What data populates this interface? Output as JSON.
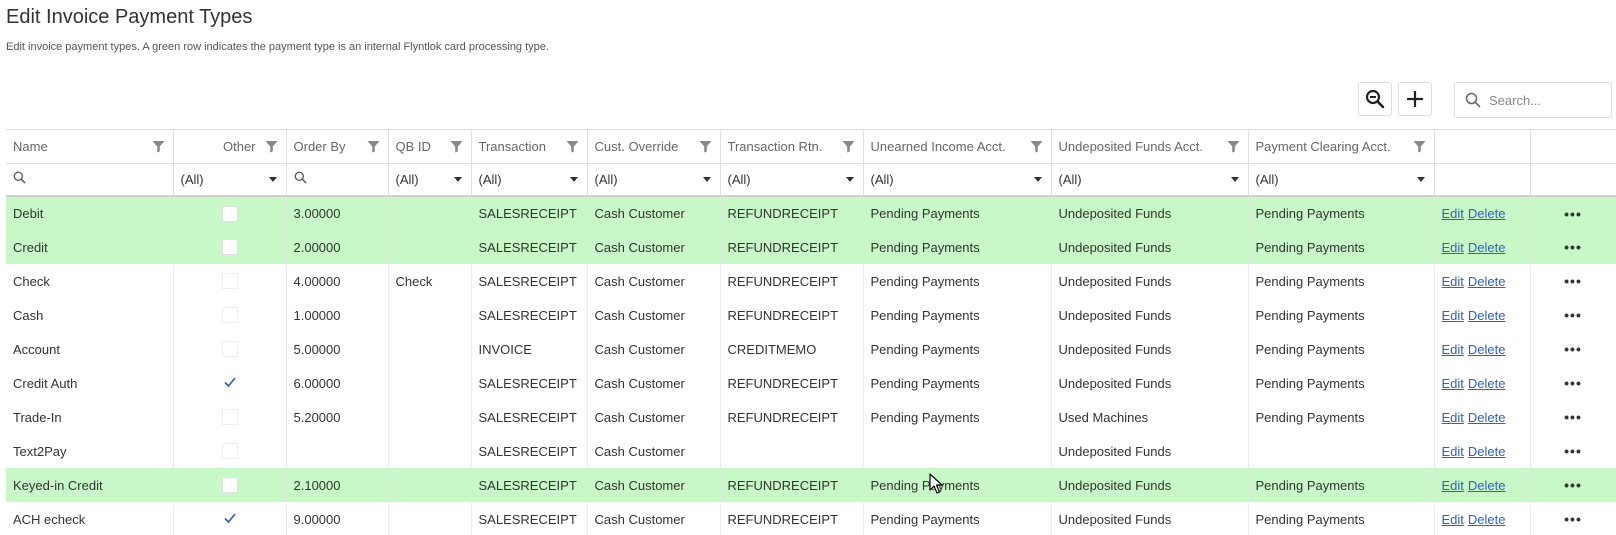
{
  "page": {
    "title": "Edit Invoice Payment Types",
    "subtitle": "Edit invoice payment types. A green row indicates the payment type is an internal Flyntlok card processing type."
  },
  "toolbar": {
    "search_placeholder": "Search...",
    "zoom_icon": "zoom-out-icon",
    "add_icon": "plus-icon"
  },
  "columns": [
    "Name",
    "Other",
    "Order By",
    "QB ID",
    "Transaction",
    "Cust. Override",
    "Transaction Rtn.",
    "Unearned Income Acct.",
    "Undeposited Funds Acct.",
    "Payment Clearing Acct."
  ],
  "filters": {
    "all": "(All)"
  },
  "actions": {
    "edit": "Edit",
    "delete": "Delete",
    "more": "•••"
  },
  "colors": {
    "internal_row": "#c8f8c8",
    "link": "#3060c0"
  },
  "rows": [
    {
      "name": "Debit",
      "other": "white",
      "order_by": "3.00000",
      "qb_id": "",
      "transaction": "SALESRECEIPT",
      "cust_override": "Cash Customer",
      "transaction_rtn": "REFUNDRECEIPT",
      "unearned": "Pending Payments",
      "undeposited": "Undeposited Funds",
      "clearing": "Pending Payments",
      "internal": true
    },
    {
      "name": "Credit",
      "other": "white",
      "order_by": "2.00000",
      "qb_id": "",
      "transaction": "SALESRECEIPT",
      "cust_override": "Cash Customer",
      "transaction_rtn": "REFUNDRECEIPT",
      "unearned": "Pending Payments",
      "undeposited": "Undeposited Funds",
      "clearing": "Pending Payments",
      "internal": true
    },
    {
      "name": "Check",
      "other": "empty",
      "order_by": "4.00000",
      "qb_id": "Check",
      "transaction": "SALESRECEIPT",
      "cust_override": "Cash Customer",
      "transaction_rtn": "REFUNDRECEIPT",
      "unearned": "Pending Payments",
      "undeposited": "Undeposited Funds",
      "clearing": "Pending Payments",
      "internal": false
    },
    {
      "name": "Cash",
      "other": "empty",
      "order_by": "1.00000",
      "qb_id": "",
      "transaction": "SALESRECEIPT",
      "cust_override": "Cash Customer",
      "transaction_rtn": "REFUNDRECEIPT",
      "unearned": "Pending Payments",
      "undeposited": "Undeposited Funds",
      "clearing": "Pending Payments",
      "internal": false
    },
    {
      "name": "Account",
      "other": "empty",
      "order_by": "5.00000",
      "qb_id": "",
      "transaction": "INVOICE",
      "cust_override": "Cash Customer",
      "transaction_rtn": "CREDITMEMO",
      "unearned": "Pending Payments",
      "undeposited": "Undeposited Funds",
      "clearing": "Pending Payments",
      "internal": false
    },
    {
      "name": "Credit Auth",
      "other": "checked",
      "order_by": "6.00000",
      "qb_id": "",
      "transaction": "SALESRECEIPT",
      "cust_override": "Cash Customer",
      "transaction_rtn": "REFUNDRECEIPT",
      "unearned": "Pending Payments",
      "undeposited": "Undeposited Funds",
      "clearing": "Pending Payments",
      "internal": false
    },
    {
      "name": "Trade-In",
      "other": "empty",
      "order_by": "5.20000",
      "qb_id": "",
      "transaction": "SALESRECEIPT",
      "cust_override": "Cash Customer",
      "transaction_rtn": "REFUNDRECEIPT",
      "unearned": "Pending Payments",
      "undeposited": "Used Machines",
      "clearing": "Pending Payments",
      "internal": false
    },
    {
      "name": "Text2Pay",
      "other": "empty",
      "order_by": "",
      "qb_id": "",
      "transaction": "SALESRECEIPT",
      "cust_override": "Cash Customer",
      "transaction_rtn": "",
      "unearned": "",
      "undeposited": "Undeposited Funds",
      "clearing": "",
      "internal": false
    },
    {
      "name": "Keyed-in Credit",
      "other": "white",
      "order_by": "2.10000",
      "qb_id": "",
      "transaction": "SALESRECEIPT",
      "cust_override": "Cash Customer",
      "transaction_rtn": "REFUNDRECEIPT",
      "unearned": "Pending Payments",
      "undeposited": "Undeposited Funds",
      "clearing": "Pending Payments",
      "internal": true
    },
    {
      "name": "ACH echeck",
      "other": "checked",
      "order_by": "9.00000",
      "qb_id": "",
      "transaction": "SALESRECEIPT",
      "cust_override": "Cash Customer",
      "transaction_rtn": "REFUNDRECEIPT",
      "unearned": "Pending Payments",
      "undeposited": "Undeposited Funds",
      "clearing": "Pending Payments",
      "internal": false
    }
  ]
}
